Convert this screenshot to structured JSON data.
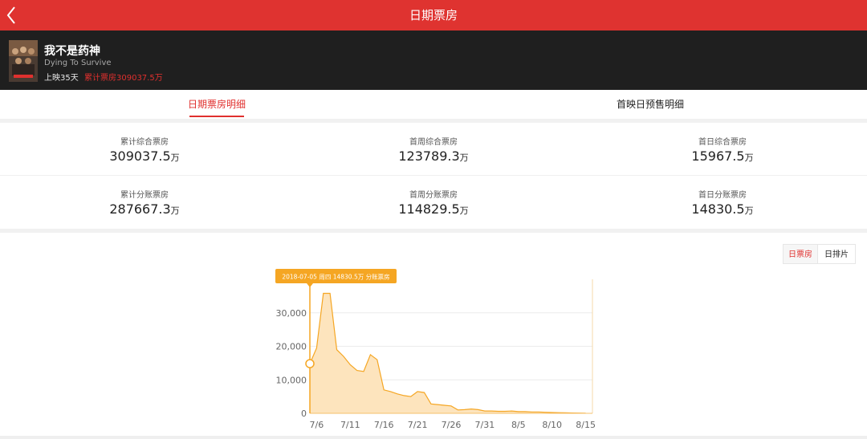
{
  "header": {
    "title": "日期票房"
  },
  "movie": {
    "name": "我不是药神",
    "en_name": "Dying To Survive",
    "days_label": "上映35天",
    "total_label": "累计票房309037.5万"
  },
  "tabs": [
    {
      "label": "日期票房明细",
      "active": true
    },
    {
      "label": "首映日预售明细",
      "active": false
    }
  ],
  "stats": [
    {
      "label": "累计综合票房",
      "value": "309037.5",
      "unit": "万"
    },
    {
      "label": "首周综合票房",
      "value": "123789.3",
      "unit": "万"
    },
    {
      "label": "首日综合票房",
      "value": "15967.5",
      "unit": "万"
    },
    {
      "label": "累计分账票房",
      "value": "287667.3",
      "unit": "万"
    },
    {
      "label": "首周分账票房",
      "value": "114829.5",
      "unit": "万"
    },
    {
      "label": "首日分账票房",
      "value": "14830.5",
      "unit": "万"
    }
  ],
  "toggles": {
    "daily_box": "日票房",
    "daily_screening": "日排片"
  },
  "colors": {
    "brand_red": "#df3330",
    "accent_red": "#e0302e",
    "chart_orange": "#f5a623",
    "chart_fill": "#fde4bd"
  },
  "chart_data": {
    "type": "area",
    "tooltip": "2018-07-05 周四 14830.5万 分账票房",
    "x_ticks": [
      "7/6",
      "7/11",
      "7/16",
      "7/21",
      "7/26",
      "7/31",
      "8/5",
      "8/10",
      "8/15"
    ],
    "y_ticks": [
      "0",
      "10,000",
      "20,000",
      "30,000"
    ],
    "ylim": [
      0,
      40000
    ],
    "grid": true,
    "series": [
      {
        "dates": [
          "7/5",
          "7/6",
          "7/7",
          "7/8",
          "7/9",
          "7/10",
          "7/11",
          "7/12",
          "7/13",
          "7/14",
          "7/15",
          "7/16",
          "7/17",
          "7/18",
          "7/19",
          "7/20",
          "7/21",
          "7/22",
          "7/23",
          "7/24",
          "7/25",
          "7/26",
          "7/27",
          "7/28",
          "7/29",
          "7/30",
          "7/31",
          "8/1",
          "8/2",
          "8/3",
          "8/4",
          "8/5",
          "8/6",
          "8/7",
          "8/8",
          "8/9",
          "8/10",
          "8/11",
          "8/12",
          "8/13",
          "8/14",
          "8/15"
        ],
        "values": [
          14830,
          19500,
          35800,
          35800,
          19000,
          17000,
          14500,
          12800,
          12500,
          17500,
          16000,
          7000,
          6500,
          5800,
          5300,
          5000,
          6500,
          6200,
          2800,
          2600,
          2400,
          2200,
          1000,
          1100,
          1300,
          1100,
          700,
          700,
          600,
          600,
          700,
          500,
          500,
          400,
          400,
          300,
          250,
          200,
          150,
          100,
          80,
          50
        ]
      }
    ]
  }
}
